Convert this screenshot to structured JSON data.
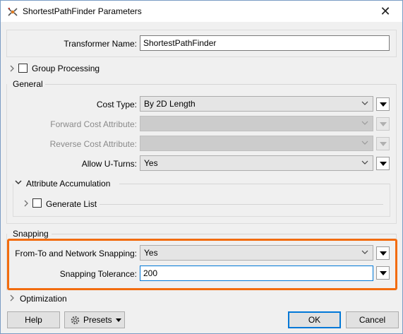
{
  "window": {
    "title": "ShortestPathFinder Parameters",
    "app_icon": "fme-transformer-icon",
    "close_glyph": "✕"
  },
  "transformer_name": {
    "label": "Transformer Name:",
    "value": "ShortestPathFinder"
  },
  "group_processing": {
    "label": "Group Processing",
    "checked": false
  },
  "general": {
    "title": "General",
    "cost_type": {
      "label": "Cost Type:",
      "value": "By 2D Length"
    },
    "forward_cost": {
      "label": "Forward Cost Attribute:",
      "value": "",
      "disabled": true
    },
    "reverse_cost": {
      "label": "Reverse Cost Attribute:",
      "value": "",
      "disabled": true
    },
    "allow_u_turns": {
      "label": "Allow U-Turns:",
      "value": "Yes"
    },
    "attribute_accumulation": {
      "title": "Attribute Accumulation",
      "generate_list": {
        "label": "Generate List",
        "checked": false
      }
    }
  },
  "snapping": {
    "title": "Snapping",
    "network_snapping": {
      "label": "From-To and Network Snapping:",
      "value": "Yes"
    },
    "tolerance": {
      "label": "Snapping Tolerance:",
      "value": "200"
    },
    "highlight_color": "#f26c0f"
  },
  "optimization": {
    "label": "Optimization"
  },
  "footer": {
    "help": "Help",
    "presets": "Presets",
    "ok": "OK",
    "cancel": "Cancel"
  },
  "colors": {
    "accent": "#0078d7",
    "highlight": "#f26c0f"
  }
}
